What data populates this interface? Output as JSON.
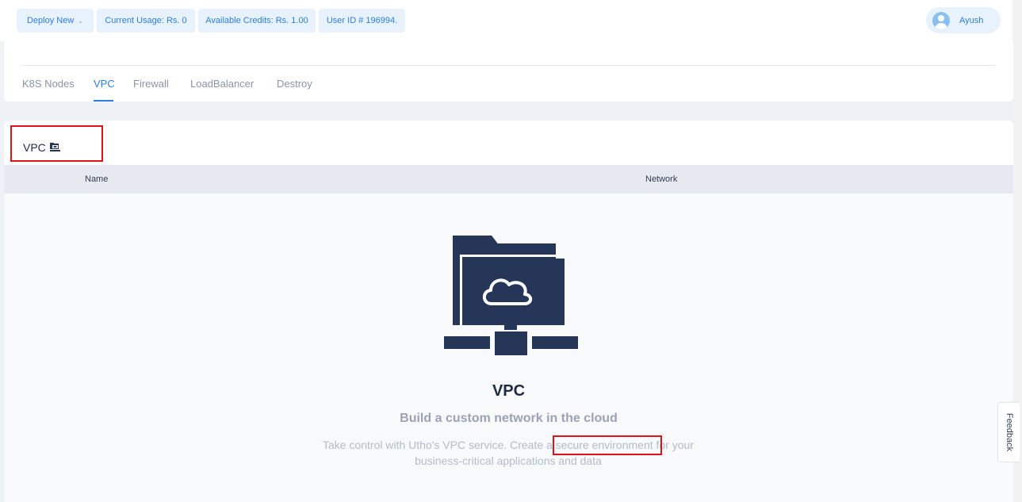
{
  "topbar": {
    "deploy_label": "Deploy New",
    "usage_label": "Current Usage: Rs. 0",
    "credits_label": "Available Credits: Rs. 1.00",
    "user_id_label": "User ID # 196994.",
    "user_name": "Ayush"
  },
  "tabs": [
    {
      "label": "K8S Nodes",
      "active": false
    },
    {
      "label": "VPC",
      "active": true
    },
    {
      "label": "Firewall",
      "active": false
    },
    {
      "label": "LoadBalancer",
      "active": false
    },
    {
      "label": "Destroy",
      "active": false
    }
  ],
  "section": {
    "title": "VPC",
    "table_headers": [
      "Name",
      "Network"
    ]
  },
  "empty_state": {
    "title": "VPC",
    "subtitle": "Build a custom network in the cloud",
    "description": "Take control with Utho's VPC service. Create a secure environment for your business-critical applications and data"
  },
  "feedback_label": "Feedback",
  "colors": {
    "accent": "#2a7ee0",
    "illustration": "#253659",
    "annotation": "#e0131a"
  }
}
